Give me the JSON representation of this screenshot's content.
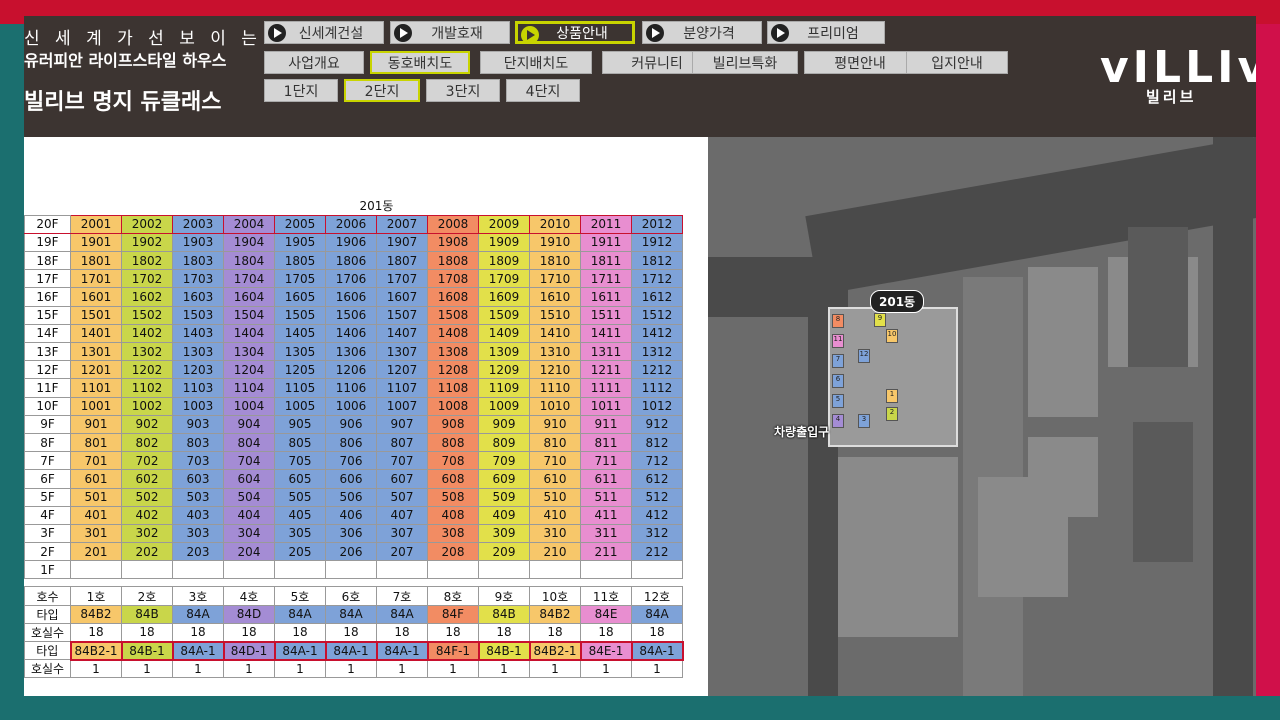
{
  "header": {
    "slogan_line1": "신 세 계 가   선 보 이 는",
    "slogan_line2": "유러피안 라이프스타일 하우스",
    "site_title": "빌리브 명지 듀클래스",
    "logo": "vILLIv",
    "logo_sub": "빌리브"
  },
  "top_nav": [
    {
      "label": "신세계건설"
    },
    {
      "label": "개발호재"
    },
    {
      "label": "상품안내"
    },
    {
      "label": "분양가격"
    },
    {
      "label": "프리미엄"
    }
  ],
  "sub_nav": [
    {
      "label": "사업개요"
    },
    {
      "label": "동호배치도"
    },
    {
      "label": "단지배치도"
    },
    {
      "label": "커뮤니티"
    },
    {
      "label": "빌리브특화"
    },
    {
      "label": "평면안내"
    },
    {
      "label": "입지안내"
    }
  ],
  "danji_tabs": [
    {
      "label": "1단지"
    },
    {
      "label": "2단지"
    },
    {
      "label": "3단지"
    },
    {
      "label": "4단지"
    }
  ],
  "table": {
    "building": "201동",
    "floors": [
      {
        "label": "20F",
        "units": [
          "2001",
          "2002",
          "2003",
          "2004",
          "2005",
          "2006",
          "2007",
          "2008",
          "2009",
          "2010",
          "2011",
          "2012"
        ]
      },
      {
        "label": "19F",
        "units": [
          "1901",
          "1902",
          "1903",
          "1904",
          "1905",
          "1906",
          "1907",
          "1908",
          "1909",
          "1910",
          "1911",
          "1912"
        ]
      },
      {
        "label": "18F",
        "units": [
          "1801",
          "1802",
          "1803",
          "1804",
          "1805",
          "1806",
          "1807",
          "1808",
          "1809",
          "1810",
          "1811",
          "1812"
        ]
      },
      {
        "label": "17F",
        "units": [
          "1701",
          "1702",
          "1703",
          "1704",
          "1705",
          "1706",
          "1707",
          "1708",
          "1709",
          "1710",
          "1711",
          "1712"
        ]
      },
      {
        "label": "16F",
        "units": [
          "1601",
          "1602",
          "1603",
          "1604",
          "1605",
          "1606",
          "1607",
          "1608",
          "1609",
          "1610",
          "1611",
          "1612"
        ]
      },
      {
        "label": "15F",
        "units": [
          "1501",
          "1502",
          "1503",
          "1504",
          "1505",
          "1506",
          "1507",
          "1508",
          "1509",
          "1510",
          "1511",
          "1512"
        ]
      },
      {
        "label": "14F",
        "units": [
          "1401",
          "1402",
          "1403",
          "1404",
          "1405",
          "1406",
          "1407",
          "1408",
          "1409",
          "1410",
          "1411",
          "1412"
        ]
      },
      {
        "label": "13F",
        "units": [
          "1301",
          "1302",
          "1303",
          "1304",
          "1305",
          "1306",
          "1307",
          "1308",
          "1309",
          "1310",
          "1311",
          "1312"
        ]
      },
      {
        "label": "12F",
        "units": [
          "1201",
          "1202",
          "1203",
          "1204",
          "1205",
          "1206",
          "1207",
          "1208",
          "1209",
          "1210",
          "1211",
          "1212"
        ]
      },
      {
        "label": "11F",
        "units": [
          "1101",
          "1102",
          "1103",
          "1104",
          "1105",
          "1106",
          "1107",
          "1108",
          "1109",
          "1110",
          "1111",
          "1112"
        ]
      },
      {
        "label": "10F",
        "units": [
          "1001",
          "1002",
          "1003",
          "1004",
          "1005",
          "1006",
          "1007",
          "1008",
          "1009",
          "1010",
          "1011",
          "1012"
        ]
      },
      {
        "label": "9F",
        "units": [
          "901",
          "902",
          "903",
          "904",
          "905",
          "906",
          "907",
          "908",
          "909",
          "910",
          "911",
          "912"
        ]
      },
      {
        "label": "8F",
        "units": [
          "801",
          "802",
          "803",
          "804",
          "805",
          "806",
          "807",
          "808",
          "809",
          "810",
          "811",
          "812"
        ]
      },
      {
        "label": "7F",
        "units": [
          "701",
          "702",
          "703",
          "704",
          "705",
          "706",
          "707",
          "708",
          "709",
          "710",
          "711",
          "712"
        ]
      },
      {
        "label": "6F",
        "units": [
          "601",
          "602",
          "603",
          "604",
          "605",
          "606",
          "607",
          "608",
          "609",
          "610",
          "611",
          "612"
        ]
      },
      {
        "label": "5F",
        "units": [
          "501",
          "502",
          "503",
          "504",
          "505",
          "506",
          "507",
          "508",
          "509",
          "510",
          "511",
          "512"
        ]
      },
      {
        "label": "4F",
        "units": [
          "401",
          "402",
          "403",
          "404",
          "405",
          "406",
          "407",
          "408",
          "409",
          "410",
          "411",
          "412"
        ]
      },
      {
        "label": "3F",
        "units": [
          "301",
          "302",
          "303",
          "304",
          "305",
          "306",
          "307",
          "308",
          "309",
          "310",
          "311",
          "312"
        ]
      },
      {
        "label": "2F",
        "units": [
          "201",
          "202",
          "203",
          "204",
          "205",
          "206",
          "207",
          "208",
          "209",
          "210",
          "211",
          "212"
        ]
      },
      {
        "label": "1F",
        "units": [
          "",
          "",
          "",
          "",
          "",
          "",
          "",
          "",
          "",
          "",
          "",
          ""
        ]
      }
    ],
    "ho_label": "호수",
    "ho": [
      "1호",
      "2호",
      "3호",
      "4호",
      "5호",
      "6호",
      "7호",
      "8호",
      "9호",
      "10호",
      "11호",
      "12호"
    ],
    "type_label": "타입",
    "types": [
      "84B2",
      "84B",
      "84A",
      "84D",
      "84A",
      "84A",
      "84A",
      "84F",
      "84B",
      "84B2",
      "84E",
      "84A"
    ],
    "count_label": "호실수",
    "counts": [
      "18",
      "18",
      "18",
      "18",
      "18",
      "18",
      "18",
      "18",
      "18",
      "18",
      "18",
      "18"
    ],
    "type2_label": "타입",
    "types2": [
      "84B2-1",
      "84B-1",
      "84A-1",
      "84D-1",
      "84A-1",
      "84A-1",
      "84A-1",
      "84F-1",
      "84B-1",
      "84B2-1",
      "84E-1",
      "84A-1"
    ],
    "count2_label": "호실수",
    "counts2": [
      "1",
      "1",
      "1",
      "1",
      "1",
      "1",
      "1",
      "1",
      "1",
      "1",
      "1",
      "1"
    ]
  },
  "map": {
    "building_label": "201동",
    "entrance_label": "차량출입구",
    "unit_numbers": [
      "1",
      "2",
      "3",
      "4",
      "5",
      "6",
      "7",
      "8",
      "9",
      "10",
      "11",
      "12"
    ]
  },
  "colors": {
    "frame_red": "#c8102e",
    "frame_teal": "#1b6f6f",
    "header_bg": "#3c3431",
    "accent": "#c8d400"
  }
}
